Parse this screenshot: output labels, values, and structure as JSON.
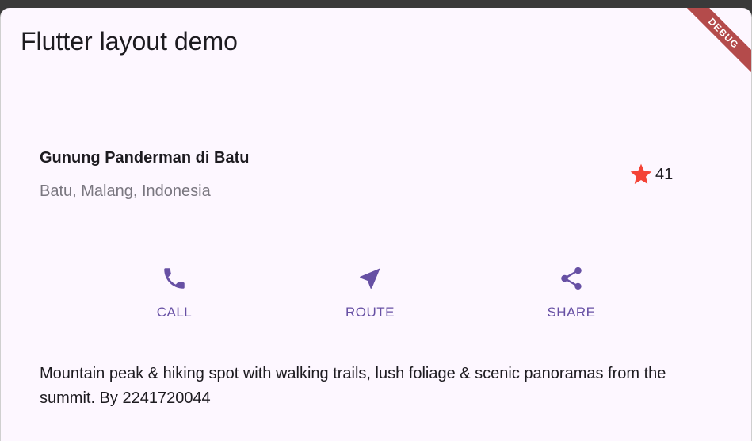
{
  "app_bar": {
    "title": "Flutter layout demo",
    "debug_label": "DEBUG"
  },
  "title_section": {
    "name": "Gunung Panderman di Batu",
    "location": "Batu, Malang, Indonesia",
    "rating": {
      "icon": "star-icon",
      "color": "#f44336",
      "count": "41"
    }
  },
  "buttons": [
    {
      "icon": "phone-icon",
      "label": "CALL"
    },
    {
      "icon": "navigation-arrow-icon",
      "label": "ROUTE"
    },
    {
      "icon": "share-icon",
      "label": "SHARE"
    }
  ],
  "accent_color": "#6750a4",
  "description": "Mountain peak & hiking spot with walking trails, lush foliage & scenic panoramas from the summit. By 2241720044"
}
